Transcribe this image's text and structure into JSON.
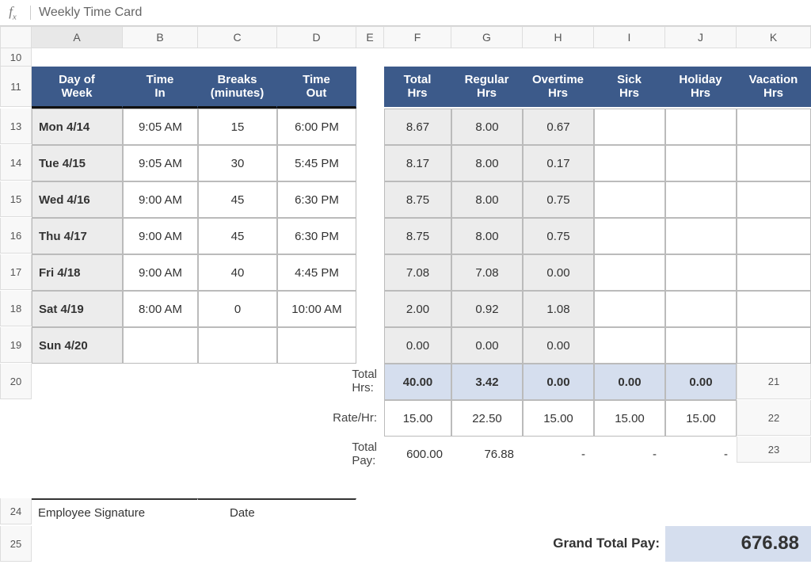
{
  "formula_bar": {
    "fx_label": "fx",
    "value": "Weekly Time Card"
  },
  "columns": [
    "A",
    "B",
    "C",
    "D",
    "E",
    "F",
    "G",
    "H",
    "I",
    "J",
    "K"
  ],
  "selected_column": "A",
  "row_numbers": [
    10,
    11,
    13,
    14,
    15,
    16,
    17,
    18,
    19,
    20,
    21,
    22,
    23,
    24,
    25
  ],
  "headers_left": [
    "Day of\nWeek",
    "Time\nIn",
    "Breaks\n(minutes)",
    "Time\nOut"
  ],
  "headers_right": [
    "Total\nHrs",
    "Regular\nHrs",
    "Overtime\nHrs",
    "Sick\nHrs",
    "Holiday\nHrs",
    "Vacation\nHrs"
  ],
  "days": [
    {
      "day": "Mon 4/14",
      "in": "9:05 AM",
      "brk": "15",
      "out": "6:00 PM",
      "tot": "8.67",
      "reg": "8.00",
      "ot": "0.67",
      "sick": "",
      "hol": "",
      "vac": ""
    },
    {
      "day": "Tue 4/15",
      "in": "9:05 AM",
      "brk": "30",
      "out": "5:45 PM",
      "tot": "8.17",
      "reg": "8.00",
      "ot": "0.17",
      "sick": "",
      "hol": "",
      "vac": ""
    },
    {
      "day": "Wed 4/16",
      "in": "9:00 AM",
      "brk": "45",
      "out": "6:30 PM",
      "tot": "8.75",
      "reg": "8.00",
      "ot": "0.75",
      "sick": "",
      "hol": "",
      "vac": ""
    },
    {
      "day": "Thu 4/17",
      "in": "9:00 AM",
      "brk": "45",
      "out": "6:30 PM",
      "tot": "8.75",
      "reg": "8.00",
      "ot": "0.75",
      "sick": "",
      "hol": "",
      "vac": ""
    },
    {
      "day": "Fri 4/18",
      "in": "9:00 AM",
      "brk": "40",
      "out": "4:45 PM",
      "tot": "7.08",
      "reg": "7.08",
      "ot": "0.00",
      "sick": "",
      "hol": "",
      "vac": ""
    },
    {
      "day": "Sat 4/19",
      "in": "8:00 AM",
      "brk": "0",
      "out": "10:00 AM",
      "tot": "2.00",
      "reg": "0.92",
      "ot": "1.08",
      "sick": "",
      "hol": "",
      "vac": ""
    },
    {
      "day": "Sun 4/20",
      "in": "",
      "brk": "",
      "out": "",
      "tot": "0.00",
      "reg": "0.00",
      "ot": "0.00",
      "sick": "",
      "hol": "",
      "vac": ""
    }
  ],
  "totals": {
    "label": "Total Hrs:",
    "reg": "40.00",
    "ot": "3.42",
    "sick": "0.00",
    "hol": "0.00",
    "vac": "0.00"
  },
  "rate": {
    "label": "Rate/Hr:",
    "reg": "15.00",
    "ot": "22.50",
    "sick": "15.00",
    "hol": "15.00",
    "vac": "15.00"
  },
  "total_pay": {
    "label": "Total Pay:",
    "reg": "600.00",
    "ot": "76.88",
    "sick": "-",
    "hol": "-",
    "vac": "-"
  },
  "signature": {
    "employee": "Employee Signature",
    "date": "Date"
  },
  "grand": {
    "label": "Grand Total Pay:",
    "value": "676.88"
  },
  "chart_data": {
    "type": "table",
    "title": "Weekly Time Card",
    "columns_left": [
      "Day of Week",
      "Time In",
      "Breaks (minutes)",
      "Time Out"
    ],
    "columns_right": [
      "Total Hrs",
      "Regular Hrs",
      "Overtime Hrs",
      "Sick Hrs",
      "Holiday Hrs",
      "Vacation Hrs"
    ],
    "rows": [
      [
        "Mon 4/14",
        "9:05 AM",
        15,
        "6:00 PM",
        8.67,
        8.0,
        0.67,
        null,
        null,
        null
      ],
      [
        "Tue 4/15",
        "9:05 AM",
        30,
        "5:45 PM",
        8.17,
        8.0,
        0.17,
        null,
        null,
        null
      ],
      [
        "Wed 4/16",
        "9:00 AM",
        45,
        "6:30 PM",
        8.75,
        8.0,
        0.75,
        null,
        null,
        null
      ],
      [
        "Thu 4/17",
        "9:00 AM",
        45,
        "6:30 PM",
        8.75,
        8.0,
        0.75,
        null,
        null,
        null
      ],
      [
        "Fri 4/18",
        "9:00 AM",
        40,
        "4:45 PM",
        7.08,
        7.08,
        0.0,
        null,
        null,
        null
      ],
      [
        "Sat 4/19",
        "8:00 AM",
        0,
        "10:00 AM",
        2.0,
        0.92,
        1.08,
        null,
        null,
        null
      ],
      [
        "Sun 4/20",
        "",
        "",
        "",
        0.0,
        0.0,
        0.0,
        null,
        null,
        null
      ]
    ],
    "totals": {
      "Regular": 40.0,
      "Overtime": 3.42,
      "Sick": 0.0,
      "Holiday": 0.0,
      "Vacation": 0.0
    },
    "rates": {
      "Regular": 15.0,
      "Overtime": 22.5,
      "Sick": 15.0,
      "Holiday": 15.0,
      "Vacation": 15.0
    },
    "pay": {
      "Regular": 600.0,
      "Overtime": 76.88,
      "Sick": null,
      "Holiday": null,
      "Vacation": null
    },
    "grand_total_pay": 676.88
  }
}
